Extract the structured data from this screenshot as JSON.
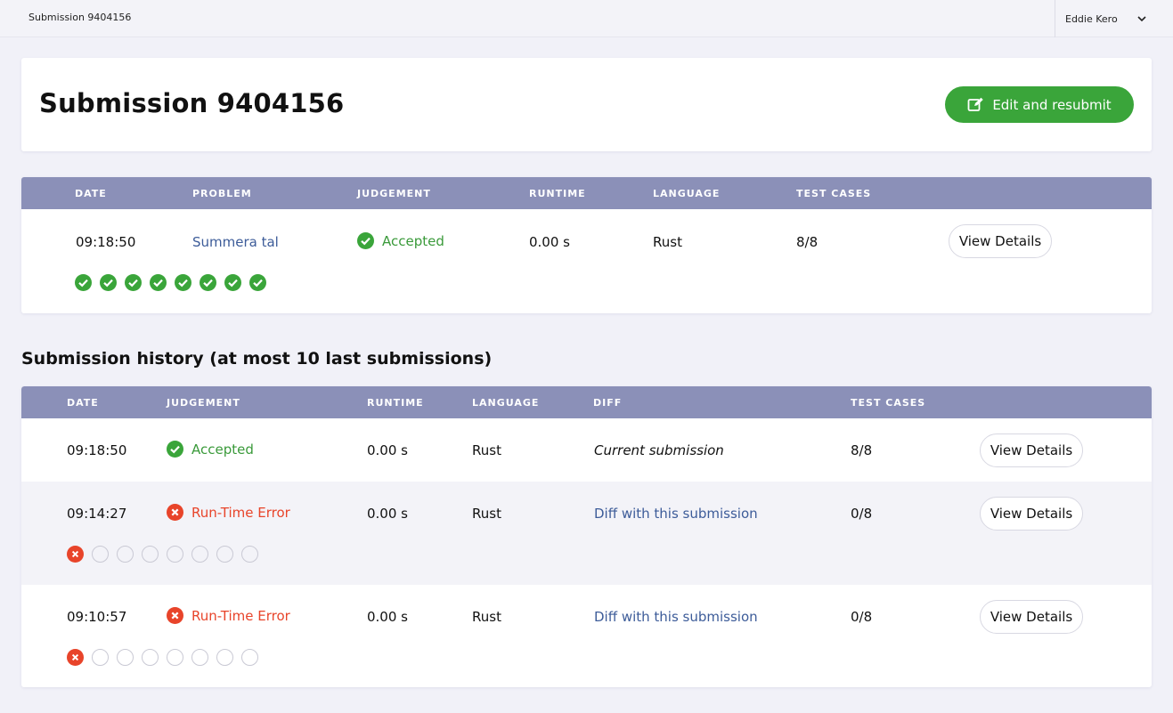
{
  "topbar": {
    "breadcrumb": "Submission 9404156",
    "user_name": "Eddie Kero"
  },
  "header": {
    "title": "Submission 9404156",
    "resubmit_label": "Edit and resubmit"
  },
  "current": {
    "columns": [
      "DATE",
      "PROBLEM",
      "JUDGEMENT",
      "RUNTIME",
      "LANGUAGE",
      "TEST CASES"
    ],
    "date": "09:18:50",
    "problem": "Summera tal",
    "judgement": "Accepted",
    "runtime": "0.00 s",
    "language": "Rust",
    "test_cases": "8/8",
    "details_label": "View Details",
    "test_results": [
      "pass",
      "pass",
      "pass",
      "pass",
      "pass",
      "pass",
      "pass",
      "pass"
    ]
  },
  "history": {
    "title": "Submission history (at most 10 last submissions)",
    "columns": [
      "DATE",
      "JUDGEMENT",
      "RUNTIME",
      "LANGUAGE",
      "DIFF",
      "TEST CASES"
    ],
    "rows": [
      {
        "date": "09:18:50",
        "judgement": "Accepted",
        "runtime": "0.00 s",
        "language": "Rust",
        "diff": "Current submission",
        "test_cases": "8/8",
        "details_label": "View Details"
      },
      {
        "date": "09:14:27",
        "judgement": "Run-Time Error",
        "runtime": "0.00 s",
        "language": "Rust",
        "diff": "Diff with this submission",
        "test_cases": "0/8",
        "details_label": "View Details",
        "test_results": [
          "fail",
          "none",
          "none",
          "none",
          "none",
          "none",
          "none",
          "none"
        ]
      },
      {
        "date": "09:10:57",
        "judgement": "Run-Time Error",
        "runtime": "0.00 s",
        "language": "Rust",
        "diff": "Diff with this submission",
        "test_cases": "0/8",
        "details_label": "View Details",
        "test_results": [
          "fail",
          "none",
          "none",
          "none",
          "none",
          "none",
          "none",
          "none"
        ]
      }
    ]
  },
  "colors": {
    "accent_green": "#3aa53a",
    "error_red": "#e8442a",
    "table_header": "#8b90b8",
    "link_blue": "#3d5c99"
  }
}
